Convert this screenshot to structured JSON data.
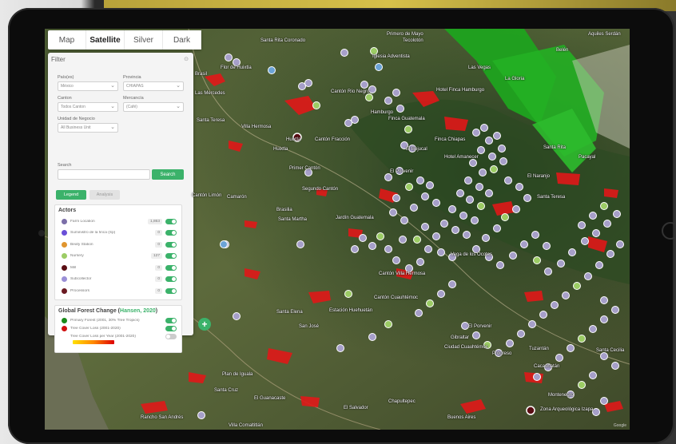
{
  "map_tabs": [
    "Map",
    "Satellite",
    "Silver",
    "Dark"
  ],
  "active_tab": "Satellite",
  "filter": {
    "title": "Filter",
    "country_label": "País(es)",
    "country_value": "México",
    "province_label": "Provincia",
    "province_value": "CHIAPAS",
    "canton_label": "Canton",
    "canton_value": "Todos Canton",
    "merc_label": "Mercancía",
    "merc_value": "(Café)",
    "unit_label": "Unidad de Negocio",
    "unit_value": "All Business Unit",
    "search_label": "Search",
    "search_button": "Search"
  },
  "tabs": {
    "legend": "Legend",
    "analysis": "Analysis"
  },
  "actors": {
    "title": "Actors",
    "items": [
      {
        "label": "Farm Location",
        "count": "1,863",
        "color": "#7b6ea8",
        "on": true
      },
      {
        "label": "Suministro de la finca (Sp)",
        "count": "0",
        "color": "#6a4fd8",
        "on": true
      },
      {
        "label": "Beafy Station",
        "count": "0",
        "color": "#e0952f",
        "on": true
      },
      {
        "label": "Nursery",
        "count": "127",
        "color": "#9ccc65",
        "on": true
      },
      {
        "label": "Mill",
        "count": "0",
        "color": "#5a0e14",
        "on": true
      },
      {
        "label": "Subcollector",
        "count": "0",
        "color": "#9a8fd6",
        "on": true
      },
      {
        "label": "Processors",
        "count": "0",
        "color": "#6b1a22",
        "on": true
      }
    ]
  },
  "gfc": {
    "title_pre": "Global Forest Change (",
    "title_link": "Hansen, 2020",
    "title_post": ")",
    "items": [
      {
        "label": "Primary Forest (2001, 30% Tree Tropics)",
        "color": "#1a8a1a",
        "on": true
      },
      {
        "label": "Tree Cover Loss (2001-2020)",
        "color": "#d01010",
        "on": true
      },
      {
        "label": "Tree Cover Loss per Year (2001-2020)",
        "color": "",
        "on": false
      }
    ]
  },
  "map_labels": [
    {
      "t": "Santa Rita Coronado"
    },
    {
      "t": "Tecolotón"
    },
    {
      "t": "Primero de Mayo"
    },
    {
      "t": "Aquiles Serdán"
    },
    {
      "t": "Iglesia Adventista"
    },
    {
      "t": "Las Vegas"
    },
    {
      "t": "La Gloria"
    },
    {
      "t": "Belén"
    },
    {
      "t": "Flor de Huixtla"
    },
    {
      "t": "Las Mercedes"
    },
    {
      "t": "Brasil"
    },
    {
      "t": "Hotel Finca Hamburgo"
    },
    {
      "t": "Cantón Río Negro"
    },
    {
      "t": "Hamburgo"
    },
    {
      "t": "Finca Guatemala"
    },
    {
      "t": "Finca Chiapas"
    },
    {
      "t": "Santa Teresa"
    },
    {
      "t": "Villa Hermosa"
    },
    {
      "t": "Huixtla"
    },
    {
      "t": "Cantón Fracción"
    },
    {
      "t": "El Bejucal"
    },
    {
      "t": "Hotel Amanecer"
    },
    {
      "t": "Santa Rita"
    },
    {
      "t": "Pacayal"
    },
    {
      "t": "Primer Cantón"
    },
    {
      "t": "El Porvenir"
    },
    {
      "t": "El Naranjo"
    },
    {
      "t": "Santa Teresa"
    },
    {
      "t": "Camarón"
    },
    {
      "t": "Segundo Cantón"
    },
    {
      "t": "Cantón Limón"
    },
    {
      "t": "Brasilia"
    },
    {
      "t": "Santa Martha"
    },
    {
      "t": "Jardín Guatemala"
    },
    {
      "t": "Vega de los Ocotes"
    },
    {
      "t": "Cantón Villa Hermosa"
    },
    {
      "t": "Cantón Cuauhtémoc"
    },
    {
      "t": "Estación Huehuetán"
    },
    {
      "t": "Santa Elena"
    },
    {
      "t": "San José"
    },
    {
      "t": "El Porvenir"
    },
    {
      "t": "Gibraltar"
    },
    {
      "t": "Ciudad Cuauhtémoc"
    },
    {
      "t": "Progreso"
    },
    {
      "t": "Santa Cecilia"
    },
    {
      "t": "Plan de Iguala"
    },
    {
      "t": "Santa Cruz"
    },
    {
      "t": "El Guanacaste"
    },
    {
      "t": "El Salvador"
    },
    {
      "t": "Buenos Aires"
    },
    {
      "t": "Chapultepec"
    },
    {
      "t": "Zona Arqueológica Izapa"
    },
    {
      "t": "Rancho San Andrés"
    },
    {
      "t": "Villa Comaltitlán"
    },
    {
      "t": "Huixtla"
    },
    {
      "t": "Montenegro"
    },
    {
      "t": "Tuzantán"
    },
    {
      "t": "Cacaohatán"
    }
  ],
  "footer": "Google"
}
